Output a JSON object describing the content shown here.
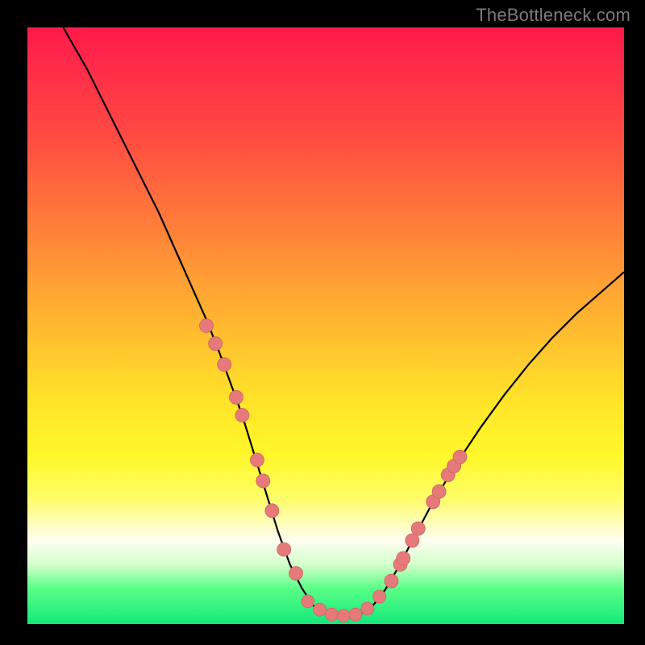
{
  "watermark": "TheBottleneck.com",
  "colors": {
    "background": "#000000",
    "curve": "#000000",
    "marker_fill": "#e67a7a",
    "marker_stroke": "#d06262"
  },
  "chart_data": {
    "type": "line",
    "title": "",
    "xlabel": "",
    "ylabel": "",
    "xlim": [
      0,
      100
    ],
    "ylim": [
      0,
      100
    ],
    "series": [
      {
        "name": "bottleneck-curve",
        "x": [
          6,
          10,
          14,
          18,
          22,
          26,
          28,
          30,
          32,
          34,
          36,
          38,
          40,
          42,
          44,
          46,
          48,
          50,
          52,
          54,
          56,
          58,
          60,
          62,
          64,
          68,
          72,
          76,
          80,
          84,
          88,
          92,
          96,
          100
        ],
        "y": [
          100,
          93,
          85,
          77,
          69,
          60,
          55.5,
          51,
          46,
          40.5,
          35,
          28.5,
          22,
          15.5,
          10,
          6,
          3,
          1.8,
          1.3,
          1.3,
          1.8,
          3.2,
          5.8,
          9.2,
          13,
          20.5,
          27,
          33,
          38.5,
          43.5,
          48,
          52,
          55.5,
          59
        ]
      }
    ],
    "markers_left": {
      "name": "left-cluster",
      "x": [
        30,
        31.5,
        33,
        35,
        36,
        38.5,
        39.5,
        41,
        43,
        45
      ],
      "y": [
        50,
        47,
        43.5,
        38,
        35,
        27.5,
        24,
        19,
        12.5,
        8.5
      ]
    },
    "markers_right": {
      "name": "right-cluster",
      "x": [
        61,
        62.5,
        63,
        64.5,
        65.5,
        68,
        69,
        70.5,
        71.5,
        72.5
      ],
      "y": [
        7.2,
        10,
        11,
        14,
        16,
        20.5,
        22.2,
        25,
        26.5,
        28
      ]
    },
    "markers_bottom": {
      "name": "bottom-cluster",
      "x": [
        47,
        49,
        51,
        53,
        55,
        57,
        59
      ],
      "y": [
        3.8,
        2.4,
        1.6,
        1.4,
        1.6,
        2.6,
        4.6
      ]
    }
  }
}
